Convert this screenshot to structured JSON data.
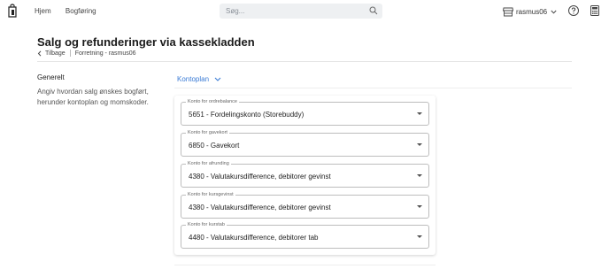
{
  "nav": {
    "home": "Hjem",
    "bookkeeping": "Bogføring"
  },
  "search": {
    "placeholder": "Søg..."
  },
  "shop": {
    "name": "rasmus06"
  },
  "page": {
    "title": "Salg og refunderinger via kassekladden",
    "back_label": "Tilbage",
    "breadcrumb": "Forretning - rasmus06"
  },
  "section": {
    "title": "Generelt",
    "description": "Angiv hvordan salg ønskes bogført, herunder kontoplan og momskoder."
  },
  "kontoplan": {
    "label": "Kontoplan"
  },
  "fields": [
    {
      "label": "Konto for ordrebalance",
      "value": "5651 - Fordelingskonto (Storebuddy)"
    },
    {
      "label": "Konto for gavekort",
      "value": "6850 - Gavekort"
    },
    {
      "label": "Konto for afrunding",
      "value": "4380 - Valutakursdifference, debitorer gevinst"
    },
    {
      "label": "Konto for kursgevinst",
      "value": "4380 - Valutakursdifference, debitorer gevinst"
    },
    {
      "label": "Konto for kurstab",
      "value": "4480 - Valutakursdifference, debitorer tab"
    }
  ],
  "colors": {
    "accent": "#3a7bd5",
    "background": "#ffffff",
    "search_bg": "#eef0f2"
  },
  "icons": [
    "logo-icon",
    "search-icon",
    "store-icon",
    "chevron-down-icon",
    "help-icon",
    "calculator-icon",
    "chevron-left-icon"
  ]
}
